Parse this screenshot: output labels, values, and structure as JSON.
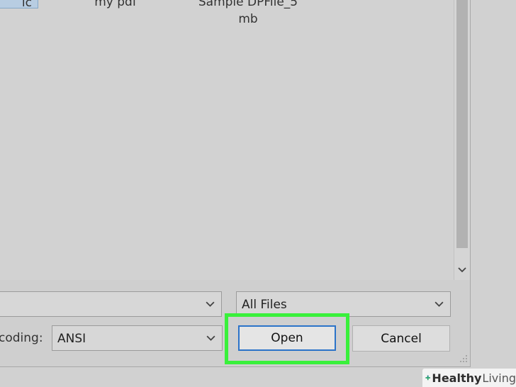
{
  "file_list": {
    "items": [
      {
        "label": "ic",
        "selected": true
      },
      {
        "label": "my pdf",
        "selected": false
      },
      {
        "label_line1": "Sample DPFile_5",
        "label_line2": "mb",
        "selected": false
      }
    ]
  },
  "controls": {
    "file_type": "All Files",
    "encoding_label": "coding:",
    "encoding_value": "ANSI",
    "open_label": "Open",
    "cancel_label": "Cancel"
  },
  "watermark": {
    "brand_bold": "Healthy",
    "brand_light": "Living"
  },
  "colors": {
    "highlight": "#39f03b",
    "focus": "#2b73c9",
    "selection": "#b8cde2"
  },
  "icons": {
    "scroll_down": "chevron-down-icon",
    "dropdown": "chevron-down-icon",
    "resize": "resize-grip-icon",
    "watermark": "cross-icon"
  }
}
